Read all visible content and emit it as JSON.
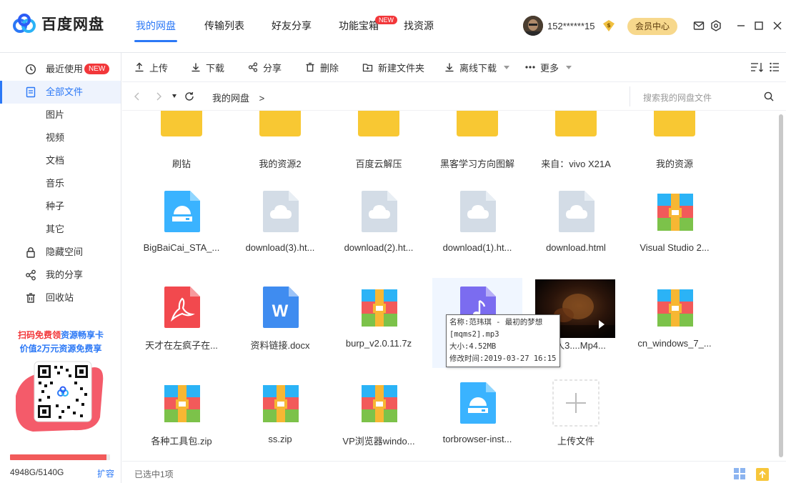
{
  "app": {
    "name": "百度网盘"
  },
  "nav": {
    "tabs": [
      {
        "label": "我的网盘"
      },
      {
        "label": "传输列表"
      },
      {
        "label": "好友分享"
      },
      {
        "label": "功能宝箱"
      },
      {
        "label": "找资源"
      }
    ],
    "new_badge": "NEW"
  },
  "user": {
    "name": "152******15",
    "member_button": "会员中心"
  },
  "sidebar": {
    "items": [
      {
        "label": "最近使用",
        "badge": "NEW"
      },
      {
        "label": "全部文件"
      },
      {
        "label": "图片"
      },
      {
        "label": "视频"
      },
      {
        "label": "文档"
      },
      {
        "label": "音乐"
      },
      {
        "label": "种子"
      },
      {
        "label": "其它"
      },
      {
        "label": "隐藏空间"
      },
      {
        "label": "我的分享"
      },
      {
        "label": "回收站"
      }
    ],
    "promo_line1_a": "扫码免费领",
    "promo_line1_b": "资源畅享卡",
    "promo_line2": "价值2万元资源免费享",
    "storage_text": "4948G/5140G",
    "storage_used_fraction": 0.9626,
    "expand_label": "扩容"
  },
  "toolbar": {
    "upload": "上传",
    "download": "下载",
    "share": "分享",
    "delete": "删除",
    "new_folder": "新建文件夹",
    "offline_download": "离线下载",
    "more": "更多"
  },
  "address": {
    "breadcrumb": "我的网盘",
    "separator": ">",
    "search_placeholder": "搜索我的网盘文件"
  },
  "files": [
    {
      "name": "刷钻",
      "type": "folder"
    },
    {
      "name": "我的资源2",
      "type": "folder"
    },
    {
      "name": "百度云解压",
      "type": "folder"
    },
    {
      "name": "黑客学习方向图解",
      "type": "folder"
    },
    {
      "name": "来自：vivo X21A",
      "type": "folder"
    },
    {
      "name": "我的资源",
      "type": "folder"
    },
    {
      "name": "BigBaiCai_STA_...",
      "type": "exe"
    },
    {
      "name": "download(3).ht...",
      "type": "cloud"
    },
    {
      "name": "download(2).ht...",
      "type": "cloud"
    },
    {
      "name": "download(1).ht...",
      "type": "cloud"
    },
    {
      "name": "download.html",
      "type": "cloud"
    },
    {
      "name": "Visual Studio 2...",
      "type": "zip"
    },
    {
      "name": "天才在左疯子在...",
      "type": "pdf"
    },
    {
      "name": "资料链接.docx",
      "type": "doc"
    },
    {
      "name": "burp_v2.0.11.7z",
      "type": "zip"
    },
    {
      "name": "范",
      "type": "audio"
    },
    {
      "name": "侍人3....Mp4...",
      "type": "video"
    },
    {
      "name": "cn_windows_7_...",
      "type": "zip"
    },
    {
      "name": "各种工具包.zip",
      "type": "zip"
    },
    {
      "name": "ss.zip",
      "type": "zip"
    },
    {
      "name": "VP浏览器windo...",
      "type": "zip"
    },
    {
      "name": "torbrowser-inst...",
      "type": "exe"
    },
    {
      "name": "上传文件",
      "type": "upload"
    }
  ],
  "tooltip": {
    "line1": "名称:范玮琪 - 最初的梦想",
    "line2": "[mqms2].mp3",
    "line3": "大小:4.52MB",
    "line4": "修改时间:2019-03-27 16:15"
  },
  "status": {
    "text": "已选中1项"
  },
  "colors": {
    "accent": "#2b78f6",
    "folder": "#f8c833",
    "danger": "#f2373a"
  }
}
